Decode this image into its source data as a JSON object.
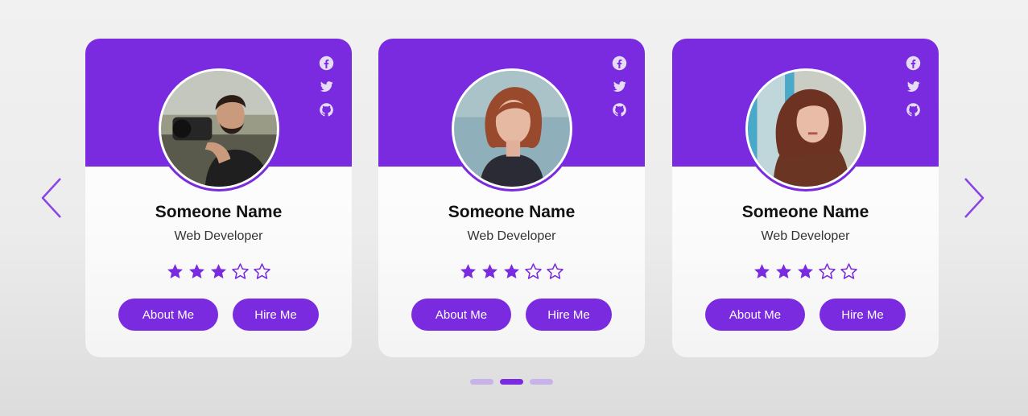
{
  "theme": {
    "accent": "#7a2be0",
    "accent_light": "#c8b2ea",
    "background": "#efefef"
  },
  "carousel": {
    "prev_icon": "chevron-left-icon",
    "next_icon": "chevron-right-icon",
    "dots": [
      {
        "active": false
      },
      {
        "active": true
      },
      {
        "active": false
      }
    ]
  },
  "cards": [
    {
      "name": "Someone Name",
      "role": "Web Developer",
      "rating": 3,
      "rating_max": 5,
      "about_label": "About Me",
      "hire_label": "Hire Me",
      "social": [
        "facebook-icon",
        "twitter-icon",
        "github-icon"
      ]
    },
    {
      "name": "Someone Name",
      "role": "Web Developer",
      "rating": 3,
      "rating_max": 5,
      "about_label": "About Me",
      "hire_label": "Hire Me",
      "social": [
        "facebook-icon",
        "twitter-icon",
        "github-icon"
      ]
    },
    {
      "name": "Someone Name",
      "role": "Web Developer",
      "rating": 3,
      "rating_max": 5,
      "about_label": "About Me",
      "hire_label": "Hire Me",
      "social": [
        "facebook-icon",
        "twitter-icon",
        "github-icon"
      ]
    }
  ]
}
